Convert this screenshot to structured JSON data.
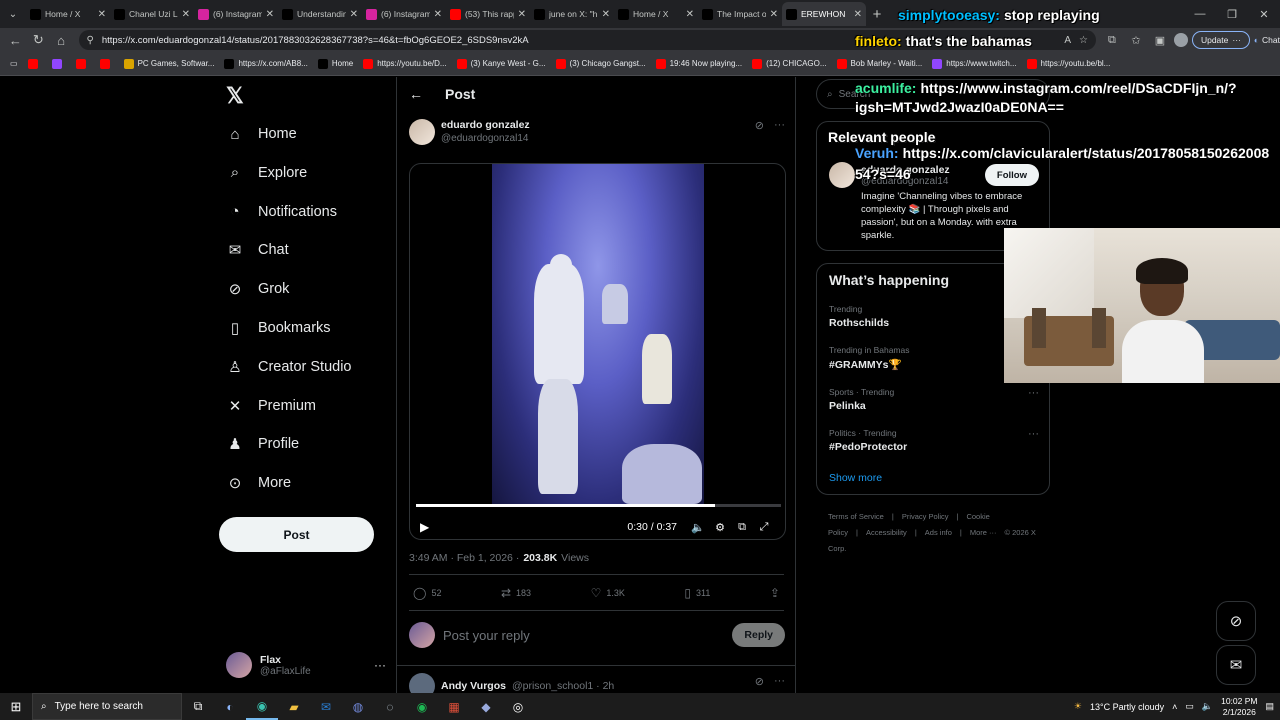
{
  "browser": {
    "tabs": [
      {
        "title": "Home / X",
        "icon": "x-icon",
        "color": "#000000",
        "active": false
      },
      {
        "title": "Chanel Uzi Le",
        "icon": "tiktok-icon",
        "color": "#000000",
        "active": false
      },
      {
        "title": "(6) Instagram",
        "icon": "instagram-icon",
        "color": "#d6249f",
        "active": false
      },
      {
        "title": "Understandin",
        "icon": "tiktok-icon",
        "color": "#000000",
        "active": false
      },
      {
        "title": "(6) Instagram",
        "icon": "instagram-icon",
        "color": "#d6249f",
        "active": false
      },
      {
        "title": "(53) This rapp",
        "icon": "youtube-icon",
        "color": "#ff0000",
        "active": false
      },
      {
        "title": "june on X: \"h",
        "icon": "x-icon",
        "color": "#000000",
        "active": false
      },
      {
        "title": "Home / X",
        "icon": "x-icon",
        "color": "#000000",
        "active": false
      },
      {
        "title": "The Impact o",
        "icon": "tiktok-icon",
        "color": "#000000",
        "active": false
      },
      {
        "title": "EREWHON",
        "icon": "x-icon",
        "color": "#000000",
        "active": true
      }
    ],
    "url": "https://x.com/eduardogonzal14/status/2017883032628367738?s=46&t=fbOg6GEOE2_6SDS9nsv2kA",
    "update_label": "Update",
    "chat_label": "Chat",
    "bookmarks": [
      {
        "label": "",
        "icon": "youtube-icon",
        "color": "#ff0000"
      },
      {
        "label": "",
        "icon": "twitch-icon",
        "color": "#9146ff"
      },
      {
        "label": "",
        "icon": "youtube-icon",
        "color": "#ff0000"
      },
      {
        "label": "",
        "icon": "youtube-icon",
        "color": "#ff0000"
      },
      {
        "label": "PC Games, Softwar...",
        "icon": "folder-icon",
        "color": "#d9a300"
      },
      {
        "label": "https://x.com/AB8...",
        "icon": "x-icon",
        "color": "#000000"
      },
      {
        "label": "Home",
        "icon": "x-icon",
        "color": "#000000"
      },
      {
        "label": "https://youtu.be/D...",
        "icon": "youtube-icon",
        "color": "#ff0000"
      },
      {
        "label": "(3) Kanye West - G...",
        "icon": "youtube-icon",
        "color": "#ff0000"
      },
      {
        "label": "(3) Chicago Gangst...",
        "icon": "youtube-icon",
        "color": "#ff0000"
      },
      {
        "label": "19:46 Now playing...",
        "icon": "youtube-icon",
        "color": "#ff0000"
      },
      {
        "label": "(12) CHICAGO...",
        "icon": "youtube-icon",
        "color": "#ff0000"
      },
      {
        "label": "Bob Marley - Waiti...",
        "icon": "youtube-icon",
        "color": "#ff0000"
      },
      {
        "label": "https://www.twitch...",
        "icon": "twitch-icon",
        "color": "#9146ff"
      },
      {
        "label": "https://youtu.be/bl...",
        "icon": "youtube-icon",
        "color": "#ff0000"
      }
    ]
  },
  "nav": {
    "items": [
      {
        "label": "Home",
        "icon": "home-icon",
        "glyph": "⌂"
      },
      {
        "label": "Explore",
        "icon": "search-icon",
        "glyph": "⌕"
      },
      {
        "label": "Notifications",
        "icon": "bell-icon",
        "glyph": "◔"
      },
      {
        "label": "Chat",
        "icon": "mail-icon",
        "glyph": "✉"
      },
      {
        "label": "Grok",
        "icon": "grok-icon",
        "glyph": "⊘"
      },
      {
        "label": "Bookmarks",
        "icon": "bookmark-icon",
        "glyph": "▯"
      },
      {
        "label": "Creator Studio",
        "icon": "creator-icon",
        "glyph": "♙"
      },
      {
        "label": "Premium",
        "icon": "x-premium-icon",
        "glyph": "✕"
      },
      {
        "label": "Profile",
        "icon": "profile-icon",
        "glyph": "♟"
      },
      {
        "label": "More",
        "icon": "more-circle-icon",
        "glyph": "⊙"
      }
    ],
    "post_label": "Post",
    "account": {
      "name": "Flax",
      "handle": "@aFlaxLife"
    }
  },
  "post": {
    "header": "Post",
    "author_name": "eduardo gonzalez",
    "author_handle": "@eduardogonzal14",
    "video_time": "0:30 / 0:37",
    "progress": 0.82,
    "timestamp": "3:49 AM · Feb 1, 2026 ·",
    "views_count": "203.8K",
    "views_label": "Views",
    "replies": "52",
    "reposts": "183",
    "likes": "1.3K",
    "bookmarks": "311",
    "reply_placeholder": "Post your reply",
    "reply_button": "Reply",
    "next_author_name": "Andy Vurgos",
    "next_author_handle": "@prison_school1 · 2h"
  },
  "sidebar": {
    "search_placeholder": "Search",
    "relevant_title": "Relevant people",
    "person_name": "eduardo gonzalez",
    "person_handle": "@eduardogonzal14",
    "follow_label": "Follow",
    "person_bio": "Imagine 'Channeling vibes to embrace complexity 📚 | Through pixels and passion', but on a Monday. with extra sparkle.",
    "happening_title": "What’s happening",
    "trends": [
      {
        "context": "Trending",
        "name": "Rothschilds"
      },
      {
        "context": "Trending in Bahamas",
        "name": "#GRAMMYs🏆"
      },
      {
        "context": "Sports · Trending",
        "name": "Pelinka"
      },
      {
        "context": "Politics · Trending",
        "name": "#PedoProtector"
      }
    ],
    "show_more": "Show more",
    "footer": [
      "Terms of Service",
      "|",
      "Privacy Policy",
      "|",
      "Cookie Policy",
      "|",
      "Accessibility",
      "|",
      "Ads info",
      "|",
      "More ···",
      "© 2026 X Corp."
    ]
  },
  "overlay_chat": [
    {
      "user": "simplytooeasy:",
      "text": "stop replaying"
    },
    {
      "user": "finleto:",
      "text": "that's the bahamas"
    },
    {
      "user": "acumlife:",
      "text": "https://www.instagram.com/reel/DSaCDFIjn_n/?"
    },
    {
      "user": "",
      "text": "igsh=MTJwd2JwazI0aDE0NA=="
    },
    {
      "user": "",
      "text": "Relevant people"
    },
    {
      "user": "Veruh:",
      "text": "https://x.com/clavicularalert/status/20178058150262008"
    },
    {
      "user": "",
      "text": "54?s=46"
    }
  ],
  "taskbar": {
    "search_placeholder": "Type here to search",
    "weather": "13°C  Partly cloudy",
    "time": "10:02 PM",
    "date": "2/1/2026"
  }
}
